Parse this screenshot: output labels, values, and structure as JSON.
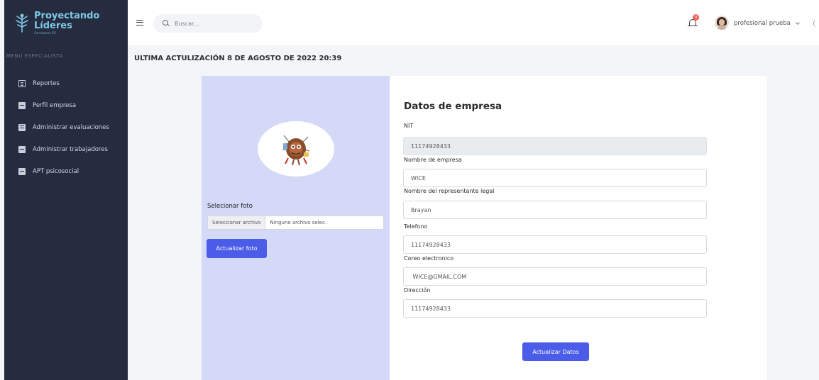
{
  "brand": {
    "line1": "Proyectando",
    "line2": "Líderes",
    "tagline": "Consultores IPS",
    "color": "#7fc8e6"
  },
  "sidebar": {
    "menu_title": "MENU ESPECIALISTA",
    "items": [
      {
        "label": "Reportes",
        "icon": "document-icon"
      },
      {
        "label": "Perfil empresa",
        "icon": "id-card-icon"
      },
      {
        "label": "Administrar evaluaciones",
        "icon": "clipboard-icon"
      },
      {
        "label": "Administrar trabajadores",
        "icon": "id-card-icon"
      },
      {
        "label": "APT psicosocial",
        "icon": "id-card-icon"
      }
    ]
  },
  "topbar": {
    "search_placeholder": "Buscar...",
    "notification_count": "0",
    "user_name": "profesional prueba"
  },
  "page": {
    "update_title": "ULTIMA ACTULIZACIÓN 8 DE AGOSTO DE 2022 20:39"
  },
  "photo": {
    "select_label": "Selecionar foto",
    "file_button": "Seleccionar archivo",
    "file_status": "Ninguno archivo selec.",
    "update_button": "Actualizar foto"
  },
  "form": {
    "title": "Datos de empresa",
    "fields": [
      {
        "label": "NIT",
        "value": "11174928433",
        "disabled": true
      },
      {
        "label": "Nombre de empresa",
        "value": "WICE"
      },
      {
        "label": "Nombre del representante legal",
        "value": "Brayan"
      },
      {
        "label": "Telefono",
        "value": "11174928433"
      },
      {
        "label": "Coreo electronico",
        "value": " WICE@GMAIL.COM"
      },
      {
        "label": "Dirección",
        "value": "11174928433"
      }
    ],
    "submit_button": "Actualizar Datos"
  },
  "colors": {
    "sidebar_bg": "#252c3f",
    "primary_button": "#4a5ce8",
    "photo_panel_bg": "#d3d9f7",
    "badge": "#f25c54"
  }
}
